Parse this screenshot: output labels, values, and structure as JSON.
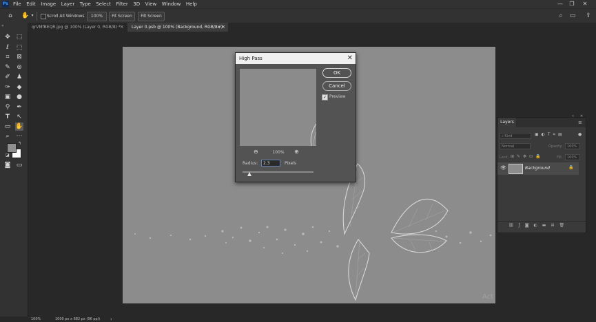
{
  "app": {
    "logo": "Ps"
  },
  "menu": [
    "File",
    "Edit",
    "Image",
    "Layer",
    "Type",
    "Select",
    "Filter",
    "3D",
    "View",
    "Window",
    "Help"
  ],
  "options": {
    "scroll_all_windows": "Scroll All Windows",
    "zoom_value": "100%",
    "fit_screen": "Fit Screen",
    "fill_screen": "Fill Screen"
  },
  "tabs": [
    {
      "label": "qrVMfBEQR.jpg @ 100% (Layer 0, RGB/8) *",
      "close": "×"
    },
    {
      "label": "Layer 0.psb @ 100% (Background, RGB/8#)",
      "close": "×"
    }
  ],
  "status": {
    "zoom": "100%",
    "doc_info": "1000 px x 682 px (96 ppi)",
    "arrow": "›"
  },
  "canvas": {
    "watermark": "Act"
  },
  "dialog": {
    "title": "High Pass",
    "ok_label": "OK",
    "cancel_label": "Cancel",
    "preview_label": "Preview",
    "preview_checked": true,
    "zoom_level": "100%",
    "radius_label": "Radius:",
    "radius_value": "2.3",
    "radius_unit": "Pixels",
    "slider_fraction": 0.1
  },
  "layers_panel": {
    "tab": "Layers",
    "kind_label": "Kind",
    "blend_mode": "Normal",
    "opacity_label": "Opacity:",
    "opacity_value": "100%",
    "lock_label": "Lock:",
    "fill_label": "Fill:",
    "fill_value": "100%",
    "layers": [
      {
        "name": "Background",
        "visible": true,
        "locked": true
      }
    ]
  },
  "colors": {
    "foreground": "#8f8f8f",
    "background": "#ffffff",
    "canvas": "#8c8c8c",
    "ui_panel": "#323232"
  }
}
